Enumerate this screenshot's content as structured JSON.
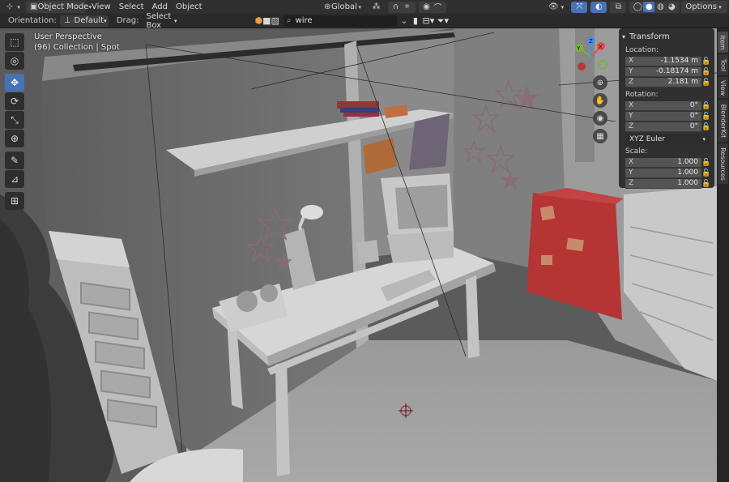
{
  "header": {
    "editor_icon": "3d-viewport-icon",
    "mode": "Object Mode",
    "menus": [
      "View",
      "Select",
      "Add",
      "Object"
    ],
    "transform_orientation": "Global",
    "options_label": "Options"
  },
  "toolheader": {
    "orientation_label": "Orientation:",
    "orientation_value": "Default",
    "drag_label": "Drag:",
    "drag_value": "Select Box",
    "search_value": "wire"
  },
  "viewport": {
    "perspective": "User Perspective",
    "collection_info": "(96) Collection | Spot"
  },
  "tools": [
    {
      "name": "select-box-icon",
      "glyph": "⬚",
      "active": false
    },
    {
      "name": "cursor-icon",
      "glyph": "◎",
      "active": false
    },
    {
      "name": "move-icon",
      "glyph": "✥",
      "active": true
    },
    {
      "name": "rotate-icon",
      "glyph": "⟳",
      "active": false
    },
    {
      "name": "scale-icon",
      "glyph": "⤡",
      "active": false
    },
    {
      "name": "transform-icon",
      "glyph": "⊕",
      "active": false
    },
    {
      "name": "annotate-icon",
      "glyph": "✎",
      "active": false
    },
    {
      "name": "measure-icon",
      "glyph": "📐",
      "active": false
    },
    {
      "name": "add-cube-icon",
      "glyph": "⊞",
      "active": false
    }
  ],
  "gizmo": {
    "x": "X",
    "y": "Y",
    "z": "Z"
  },
  "nav_buttons": [
    {
      "name": "zoom-icon",
      "glyph": "⊕"
    },
    {
      "name": "pan-hand-icon",
      "glyph": "✋"
    },
    {
      "name": "camera-icon",
      "glyph": "◉"
    },
    {
      "name": "grid-ortho-icon",
      "glyph": "▦"
    }
  ],
  "transform_panel": {
    "title": "Transform",
    "location_label": "Location:",
    "location": [
      {
        "axis": "X",
        "value": "-1.1534 m"
      },
      {
        "axis": "Y",
        "value": "-0.18174 m"
      },
      {
        "axis": "Z",
        "value": "2.181 m"
      }
    ],
    "rotation_label": "Rotation:",
    "rotation": [
      {
        "axis": "X",
        "value": "0°"
      },
      {
        "axis": "Y",
        "value": "0°"
      },
      {
        "axis": "Z",
        "value": "0°"
      }
    ],
    "rotation_mode": "XYZ Euler",
    "scale_label": "Scale:",
    "scale": [
      {
        "axis": "X",
        "value": "1.000"
      },
      {
        "axis": "Y",
        "value": "1.000"
      },
      {
        "axis": "Z",
        "value": "1.000"
      }
    ]
  },
  "side_tabs": [
    "Item",
    "Tool",
    "View",
    "BlenderKit",
    "Resources"
  ],
  "colors": {
    "accent": "#4772b3",
    "gizmo_x": "#e64a4a",
    "gizmo_y": "#79b33a",
    "gizmo_z": "#4b8df0",
    "fridge": "#b53535",
    "stars": "#8a6a78"
  }
}
